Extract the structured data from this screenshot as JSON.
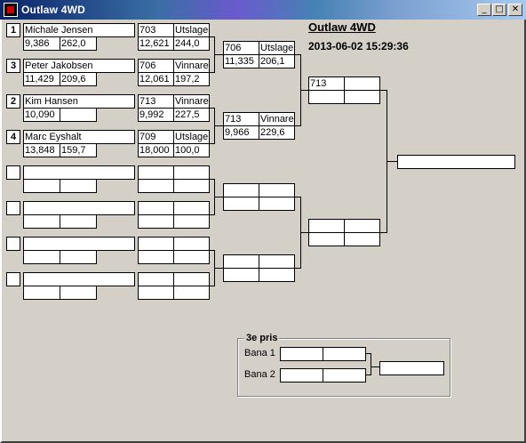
{
  "window": {
    "title": "Outlaw 4WD",
    "minimize": "_",
    "maximize": "□",
    "close": "✕"
  },
  "header": {
    "title": "Outlaw 4WD",
    "datetime": "2013-06-02 15:29:36"
  },
  "seeds": [
    "1",
    "3",
    "2",
    "4"
  ],
  "round1": [
    {
      "name": "Michale Jensen",
      "time": "9,386",
      "speed": "262,0"
    },
    {
      "name": "Peter Jakobsen",
      "time": "11,429",
      "speed": "209,6"
    },
    {
      "name": "Kim Hansen",
      "time": "10,090",
      "speed": ""
    },
    {
      "name": "Marc Eyshalt",
      "time": "13,848",
      "speed": "159,7"
    }
  ],
  "round2": [
    {
      "num": "703",
      "status": "Utslagen",
      "time": "12,621",
      "speed": "244,0"
    },
    {
      "num": "706",
      "status": "Vinnare",
      "time": "12,061",
      "speed": "197,2"
    },
    {
      "num": "713",
      "status": "Vinnare",
      "time": "9,992",
      "speed": "227,5"
    },
    {
      "num": "709",
      "status": "Utslagen",
      "time": "18,000",
      "speed": "100,0"
    }
  ],
  "round3": [
    {
      "num": "706",
      "status": "Utslagen",
      "time": "11,335",
      "speed": "206,1"
    },
    {
      "num": "713",
      "status": "Vinnare",
      "time": "9,966",
      "speed": "229,6"
    }
  ],
  "round4": [
    {
      "num": "713",
      "status": "",
      "time": "",
      "speed": ""
    }
  ],
  "third_place": {
    "title": "3e pris",
    "lane1": "Bana 1",
    "lane2": "Bana 2"
  }
}
